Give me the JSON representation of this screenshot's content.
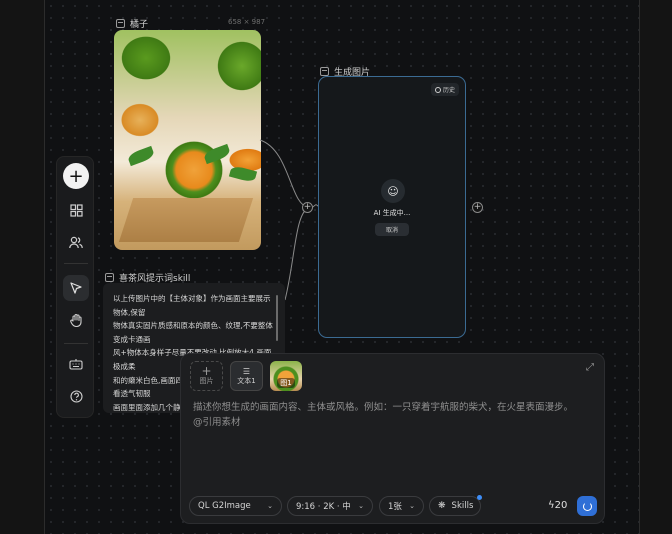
{
  "canvas": {
    "image_node": {
      "label": "橘子",
      "dimensions": "658 × 987"
    },
    "generated_node": {
      "label": "生成图片",
      "history_label": "历史",
      "status": "AI 生成中...",
      "cancel_label": "取消"
    },
    "text_node": {
      "label": "喜茶风提示词skill",
      "lines": [
        "以上传图片中的【主体对象】作为画面主要展示",
        "物体,保留",
        "物体真实固片质感和原本的颜色、纹理,不要整体",
        "变成卡通画",
        "风+物体本身样子尽量不要改动 比例放大4   画面",
        "极成柔",
        "和的癞米白色,画面四",
        "看透气韧服",
        "画面里面添加几个静"
      ]
    }
  },
  "prompt_panel": {
    "add_image_label": "图片",
    "text_ref_label": "文本1",
    "image_ref_label": "图1",
    "placeholder": "描述你想生成的画面内容、主体或风格。例如：一只穿着宇航服的柴犬，在火星表面漫步。",
    "ref_hint": "@引用素材",
    "model": "QL G2Image",
    "ratio": "9:16 · 2K · 中",
    "count": "1张",
    "skills_label": "Skills",
    "credits": "20"
  },
  "colors": {
    "accent": "#3b6b93",
    "submit": "#2f6fd6"
  }
}
